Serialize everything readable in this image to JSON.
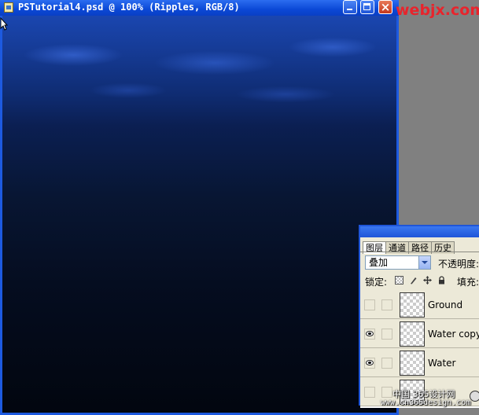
{
  "window": {
    "title": "PSTutorial4.psd @ 100% (Ripples, RGB/8)",
    "close_glyph": "×"
  },
  "watermark": "webjx.com",
  "layers_panel": {
    "tabs": [
      {
        "label": "图层",
        "active": true
      },
      {
        "label": "通道",
        "active": false
      },
      {
        "label": "路径",
        "active": false
      },
      {
        "label": "历史",
        "active": false
      }
    ],
    "blend_mode": "叠加",
    "opacity_label": "不透明度:",
    "lock_label": "锁定:",
    "fill_label": "填充:",
    "layers": [
      {
        "name": "Ground",
        "visible": false
      },
      {
        "name": "Water copy",
        "visible": true
      },
      {
        "name": "Water",
        "visible": true
      },
      {
        "name": "",
        "visible": false
      }
    ]
  },
  "bottom_watermark": {
    "line1": "中国 365设计网",
    "line2": "www.cn365design.com"
  },
  "colors": {
    "titlebar": "#0b48d6",
    "canvas_top": "#1a46b0",
    "canvas_bottom": "#02060f",
    "watermark": "#e8242c"
  }
}
